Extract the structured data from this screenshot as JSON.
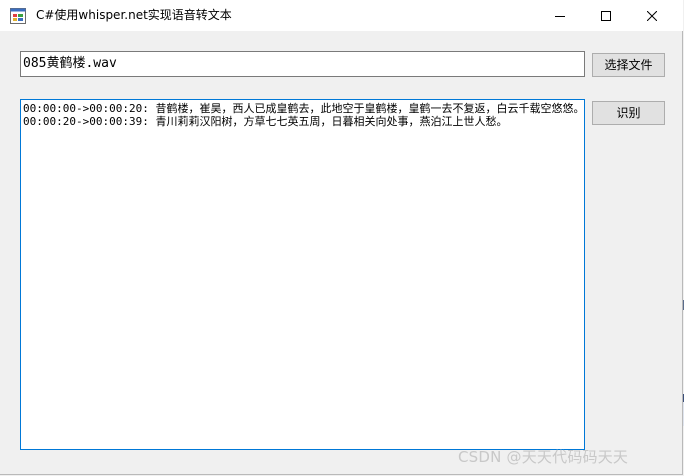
{
  "window": {
    "title": "C#使用whisper.net实现语音转文本"
  },
  "file_input": {
    "value": "085黄鹤楼.wav"
  },
  "buttons": {
    "select_file": "选择文件",
    "recognize": "识别"
  },
  "output": {
    "lines": [
      "00:00:00->00:00:20: 昔鹤楼，崔昊，西人已成皇鹤去，此地空于皇鹤楼，皇鹤一去不复返，白云千载空悠悠。",
      "00:00:20->00:00:39: 青川莉莉汉阳树，方草七七英五周，日暮相关向处事，燕泊江上世人愁。"
    ]
  },
  "watermark": {
    "text": "CSDN @天天代码码天天"
  },
  "colors": {
    "accent": "#0078d7",
    "button_bg": "#e1e1e1",
    "window_bg": "#f0f0f0"
  }
}
